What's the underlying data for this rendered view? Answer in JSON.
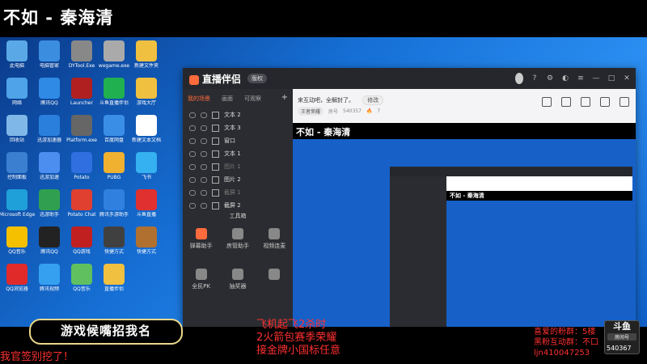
{
  "stream": {
    "title": "不如 - 秦海清"
  },
  "desktop_icons": [
    {
      "label": "此电脑",
      "color": "#5aa9e6"
    },
    {
      "label": "电脑管家",
      "color": "#3b8de0"
    },
    {
      "label": "DYTool.Exe",
      "color": "#888888"
    },
    {
      "label": "wegame.exe",
      "color": "#aaaaaa"
    },
    {
      "label": "新建文件夹",
      "color": "#f0c040"
    },
    {
      "label": "网络",
      "color": "#4fa3e8"
    },
    {
      "label": "腾讯QQ",
      "color": "#2f8ae6"
    },
    {
      "label": "Launcher",
      "color": "#b02020"
    },
    {
      "label": "斗鱼直播伴侣",
      "color": "#20b050"
    },
    {
      "label": "游戏大厅",
      "color": "#f0c040"
    },
    {
      "label": "回收站",
      "color": "#7fb8e8"
    },
    {
      "label": "迅游加速器",
      "color": "#2a7fdc"
    },
    {
      "label": "Platform.exe",
      "color": "#666666"
    },
    {
      "label": "百度网盘",
      "color": "#3a8ee6"
    },
    {
      "label": "新建文本文档",
      "color": "#ffffff"
    },
    {
      "label": "控制面板",
      "color": "#3a7fd0"
    },
    {
      "label": "迅游加速",
      "color": "#4b8ef0"
    },
    {
      "label": "Potato",
      "color": "#2f6fe0"
    },
    {
      "label": "PUBG",
      "color": "#f0b030"
    },
    {
      "label": "飞书",
      "color": "#35b0f0"
    },
    {
      "label": "Microsoft Edge",
      "color": "#1fa0d8"
    },
    {
      "label": "迅游助手",
      "color": "#30a050"
    },
    {
      "label": "Potato Chat",
      "color": "#e04030"
    },
    {
      "label": "腾讯手游助手",
      "color": "#3080e0"
    },
    {
      "label": "斗鱼直播",
      "color": "#e03030"
    },
    {
      "label": "QQ音乐",
      "color": "#f5c000"
    },
    {
      "label": "腾讯QQ",
      "color": "#222222"
    },
    {
      "label": "QQ游戏",
      "color": "#c02020"
    },
    {
      "label": "快捷方式",
      "color": "#404040"
    },
    {
      "label": "快捷方式",
      "color": "#b07030"
    },
    {
      "label": "QQ浏览器",
      "color": "#e02a2a"
    },
    {
      "label": "腾讯视频",
      "color": "#35a0f0"
    },
    {
      "label": "QQ音乐",
      "color": "#60c060"
    },
    {
      "label": "直播伴侣",
      "color": "#f0c040"
    }
  ],
  "app": {
    "logo": "直播伴侣",
    "badge": "版权",
    "tabs": [
      "我的场景",
      "画面",
      "可观察"
    ],
    "scenes": [
      {
        "label": "文本 2",
        "dim": false
      },
      {
        "label": "文本 3",
        "dim": false
      },
      {
        "label": "窗口",
        "dim": false
      },
      {
        "label": "文本 1",
        "dim": false
      },
      {
        "label": "图片 1",
        "dim": true
      },
      {
        "label": "图片 2",
        "dim": false
      },
      {
        "label": "截屏 1",
        "dim": true
      },
      {
        "label": "截屏 2",
        "dim": false
      }
    ],
    "toolbox_label": "工具箱",
    "tools": [
      {
        "label": "弹幕助手",
        "color": "#ff6b3d"
      },
      {
        "label": "房管助手",
        "color": "#888888"
      },
      {
        "label": "视频连麦",
        "color": "#888888"
      }
    ],
    "tools2": [
      {
        "label": "全民PK",
        "color": "#888888"
      },
      {
        "label": "抽奖器",
        "color": "#888888"
      },
      {
        "label": "",
        "color": "#888888"
      }
    ],
    "prompt": "来互动吧，全解封了。",
    "edit_btn": "修改",
    "game_tag": "王者荣耀",
    "room_label": "房号",
    "room_number": "540357",
    "heat": "7",
    "preview_title": "不如 - 秦海清",
    "nested_title": "不如 - 秦海清"
  },
  "overlay": {
    "brand_banner": "游戏候嘴招我名",
    "chat_line": "我官签别挖了！",
    "center_lines": [
      "飞机起飞2杀时",
      "2火箭包赛季荣耀",
      "接金牌小国标任意"
    ],
    "right_lines": [
      "喜爱的粉群：5楼",
      "黑粉互动群：不口",
      "ljn410047253"
    ],
    "douyu_logo": "斗鱼",
    "douyu_sub": "房间号",
    "room_id": "540367"
  }
}
